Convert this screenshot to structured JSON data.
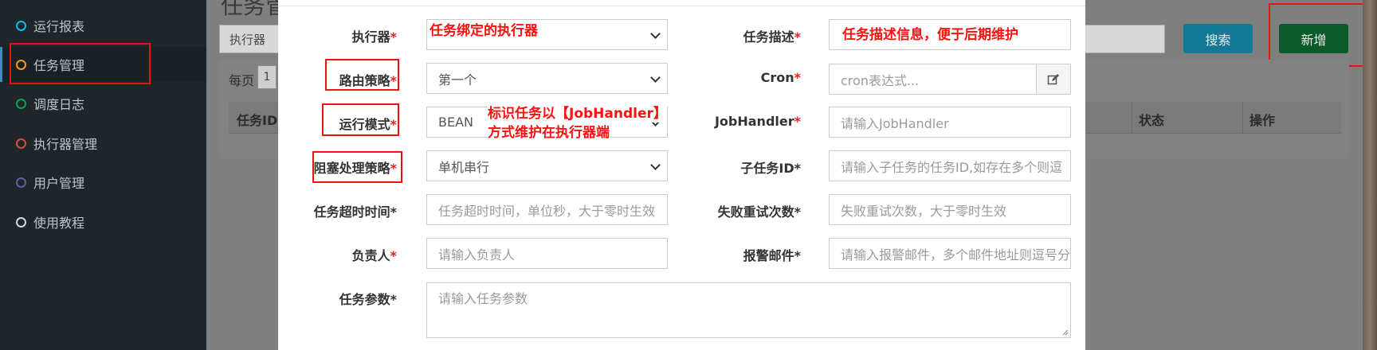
{
  "sidebar": {
    "items": [
      {
        "label": "运行报表",
        "color": "#00c0ef"
      },
      {
        "label": "任务管理",
        "color": "#f39c12"
      },
      {
        "label": "调度日志",
        "color": "#00a65a"
      },
      {
        "label": "执行器管理",
        "color": "#dd4b39"
      },
      {
        "label": "用户管理",
        "color": "#605ca8"
      },
      {
        "label": "使用教程",
        "color": "#d2d6de"
      }
    ]
  },
  "background": {
    "page_title": "任务管",
    "filter_label": "执行器",
    "filter_value": "",
    "search_label": "搜索",
    "add_label": "新增",
    "perpage_label": "每页",
    "perpage_value": "1",
    "table_headers": {
      "id": "任务ID",
      "status": "状态",
      "operation": "操作"
    }
  },
  "modal": {
    "executor": {
      "label": "执行器",
      "req": "*",
      "value": ""
    },
    "description": {
      "label": "任务描述",
      "req": "*",
      "placeholder": ""
    },
    "route_strategy": {
      "label": "路由策略",
      "req": "*",
      "value": "第一个"
    },
    "cron": {
      "label": "Cron",
      "req": "*",
      "placeholder": "cron表达式..."
    },
    "run_mode": {
      "label": "运行模式",
      "req": "*",
      "value": "BEAN"
    },
    "job_handler": {
      "label": "JobHandler",
      "req": "*",
      "placeholder": "请输入JobHandler"
    },
    "block_strategy": {
      "label": "阻塞处理策略",
      "req": "*",
      "value": "单机串行"
    },
    "child_job_id": {
      "label": "子任务ID*",
      "placeholder": "请输入子任务的任务ID,如存在多个则逗"
    },
    "timeout": {
      "label": "任务超时时间*",
      "placeholder": "任务超时时间，单位秒，大于零时生效"
    },
    "retry": {
      "label": "失败重试次数*",
      "placeholder": "失败重试次数，大于零时生效"
    },
    "owner": {
      "label": "负责人",
      "req": "*",
      "placeholder": "请输入负责人"
    },
    "alarm_email": {
      "label": "报警邮件*",
      "placeholder": "请输入报警邮件，多个邮件地址则逗号分"
    },
    "params": {
      "label": "任务参数*",
      "placeholder": "请输入任务参数"
    }
  },
  "annotations": {
    "executor_note": "任务绑定的执行器",
    "description_note": "任务描述信息，便于后期维护",
    "run_mode_note_line1": "标识任务以【JobHandler】",
    "run_mode_note_line2": "方式维护在执行器端"
  },
  "colors": {
    "required": "#dd2222",
    "annotation": "#ff1010",
    "search_button": "#00c0ef",
    "add_button": "#00a65a"
  }
}
